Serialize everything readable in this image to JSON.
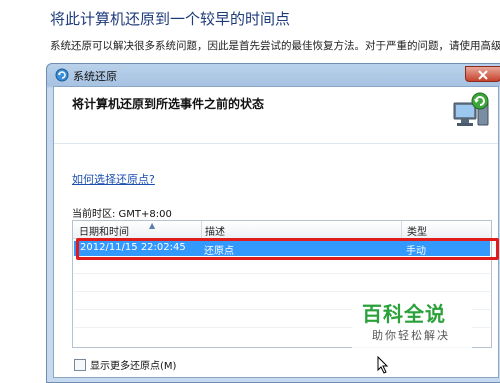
{
  "background": {
    "title": "将此计算机还原到一个较早的时间点",
    "description": "系统还原可以解决很多系统问题，因此是首先尝试的最佳恢复方法。对于严重的问题，请使用高级恢复方法。"
  },
  "window": {
    "title": "系统还原",
    "heading": "将计算机还原到所选事件之前的状态",
    "help_link": "如何选择还原点?",
    "timezone": "当前时区: GMT+8:00",
    "columns": [
      "日期和时间",
      "描述",
      "类型"
    ],
    "rows": [
      {
        "datetime": "2012/11/15 22:02:45",
        "description": "还原点",
        "type": "手动",
        "selected": true
      }
    ],
    "show_more_label": "显示更多还原点(M)"
  },
  "watermark": {
    "title": "百科全说",
    "subtitle": "助你轻松解决"
  },
  "colors": {
    "selection": "#3399ff",
    "highlight_box": "#e01b1b",
    "link": "#1a4fb0"
  }
}
